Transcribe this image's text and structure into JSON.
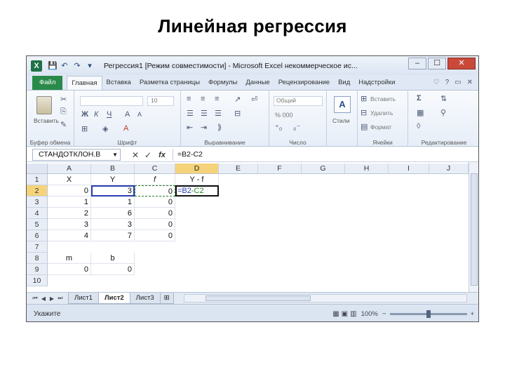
{
  "slide": {
    "title": "Линейная регрессия"
  },
  "window": {
    "title": "Регрессия1 [Режим совместимости] - Microsoft Excel некоммерческое ис...",
    "minimize": "–",
    "maximize": "☐",
    "close": "✕"
  },
  "qat": [
    "💾",
    "↶",
    "↷",
    "▾"
  ],
  "tabs": [
    "Файл",
    "Главная",
    "Вставка",
    "Разметка страницы",
    "Формулы",
    "Данные",
    "Рецензирование",
    "Вид",
    "Надстройки"
  ],
  "tab_right": [
    "♡",
    "?",
    "▭",
    "✕"
  ],
  "ribbon": {
    "paste": "Вставить",
    "clipboard_label": "Буфер обмена",
    "font_name": "",
    "font_size": "10",
    "font_label": "Шрифт",
    "align_label": "Выравнивание",
    "number_format": "Общий",
    "number_label": "Число",
    "styles": "Стили",
    "insert": "Вставить",
    "delete": "Удалить",
    "format": "Формат",
    "cells_label": "Ячейки",
    "edit_label": "Редактирование",
    "bold": "Ж",
    "italic": "К",
    "underline": "Ч",
    "percent": "% 000",
    "sigma": "Σ"
  },
  "formula_bar": {
    "name_box": "СТАНДОТКЛОН.В",
    "cancel": "✕",
    "enter": "✓",
    "fx": "fx",
    "formula": "=B2-C2"
  },
  "columns": [
    "A",
    "B",
    "C",
    "D",
    "E",
    "F",
    "G",
    "H",
    "I",
    "J"
  ],
  "rows": [
    {
      "n": "1",
      "cells": {
        "A": "X",
        "B": "Y",
        "C": "f",
        "D": "Y - f"
      }
    },
    {
      "n": "2",
      "cells": {
        "A": "0",
        "B": "3",
        "C": "0",
        "D_a": "=B2",
        "D_b": "-C2"
      }
    },
    {
      "n": "3",
      "cells": {
        "A": "1",
        "B": "1",
        "C": "0"
      }
    },
    {
      "n": "4",
      "cells": {
        "A": "2",
        "B": "6",
        "C": "0"
      }
    },
    {
      "n": "5",
      "cells": {
        "A": "3",
        "B": "3",
        "C": "0"
      }
    },
    {
      "n": "6",
      "cells": {
        "A": "4",
        "B": "7",
        "C": "0"
      }
    },
    {
      "n": "7",
      "cells": {}
    },
    {
      "n": "8",
      "cells": {
        "A": "m",
        "B": "b"
      }
    },
    {
      "n": "9",
      "cells": {
        "A": "0",
        "B": "0"
      }
    },
    {
      "n": "10",
      "cells": {}
    }
  ],
  "sheets": [
    "Лист1",
    "Лист2",
    "Лист3"
  ],
  "active_sheet": "Лист2",
  "status": {
    "mode": "Укажите",
    "zoom": "100%",
    "minus": "−",
    "plus": "+"
  }
}
